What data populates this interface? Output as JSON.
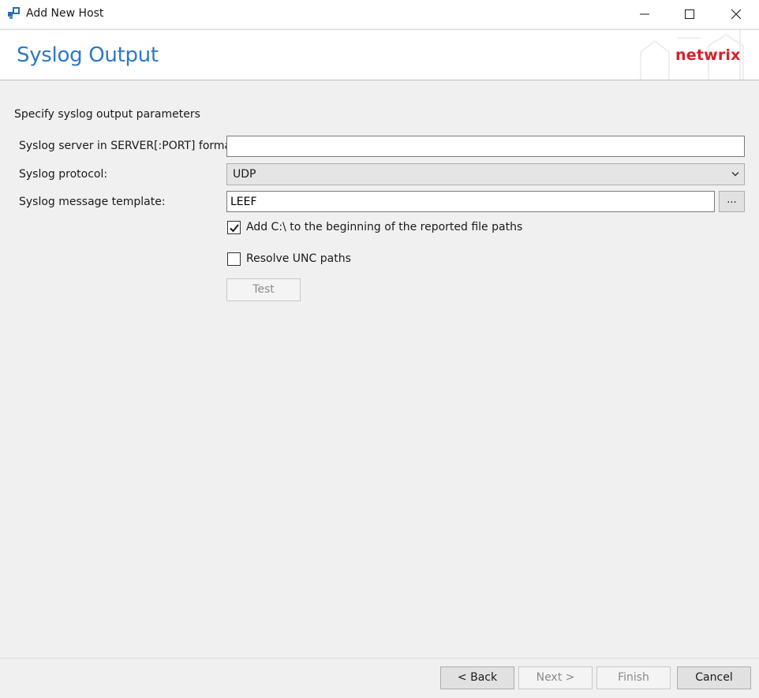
{
  "window": {
    "title": "Add New Host",
    "app_icon": "netwrix-app-icon",
    "controls": [
      "minimize-icon",
      "maximize-icon",
      "close-icon"
    ]
  },
  "header": {
    "title": "Syslog Output",
    "brand": "netwrix"
  },
  "form": {
    "instructions": "Specify syslog output parameters",
    "server_label": "Syslog server in SERVER[:PORT] format:",
    "server_value": "",
    "protocol_label": "Syslog protocol:",
    "protocol_value": "UDP",
    "template_label": "Syslog message template:",
    "template_value": "LEEF",
    "browse_label": "...",
    "add_c_label": "Add C:\\ to the beginning of the reported file paths",
    "add_c_checked": true,
    "resolve_unc_label": "Resolve UNC paths",
    "resolve_unc_checked": false,
    "test_label": "Test"
  },
  "footer": {
    "back_label": "< Back",
    "next_label": "Next >",
    "finish_label": "Finish",
    "cancel_label": "Cancel"
  },
  "colors": {
    "title_blue": "#2e78c5",
    "brand_red": "#d1232a",
    "background": "#f0f0f0"
  }
}
